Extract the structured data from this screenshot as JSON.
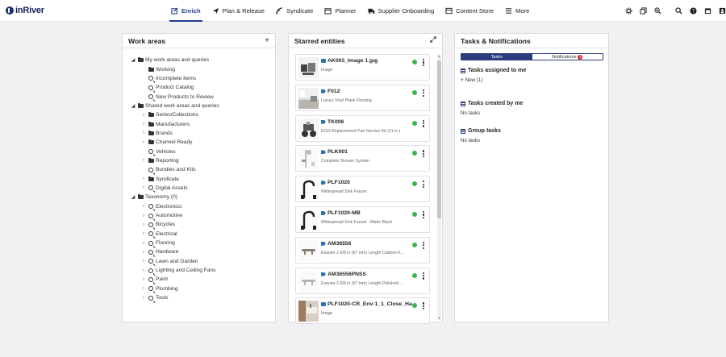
{
  "app": {
    "logo_text": "inRiver"
  },
  "nav": {
    "items": [
      {
        "label": "Enrich",
        "icon": "edit-icon",
        "active": true
      },
      {
        "label": "Plan & Release",
        "icon": "plane-icon"
      },
      {
        "label": "Syndicate",
        "icon": "syndicate-icon"
      },
      {
        "label": "Planner",
        "icon": "calendar-icon"
      },
      {
        "label": "Supplier Onboarding",
        "icon": "truck-icon"
      },
      {
        "label": "Content Store",
        "icon": "content-store-icon"
      },
      {
        "label": "More",
        "icon": "menu-icon"
      }
    ]
  },
  "toolbar": {
    "left_icons": [
      "settings-icon",
      "copy-icon",
      "zoom-in-icon"
    ],
    "right_icons": [
      "search-icon",
      "help-icon",
      "calendar-icon",
      "user-icon"
    ]
  },
  "work_areas": {
    "title": "Work areas",
    "add_label": "+",
    "tree": [
      {
        "label": "My work areas and queries",
        "type": "folder",
        "level": 0,
        "expanded": true
      },
      {
        "label": "Working",
        "type": "folder",
        "level": 1
      },
      {
        "label": "Incomplete Items",
        "type": "query",
        "level": 1
      },
      {
        "label": "Product Catalog",
        "type": "query",
        "level": 1
      },
      {
        "label": "New Products to Review",
        "type": "query",
        "level": 1
      },
      {
        "label": "Shared work areas and queries",
        "type": "folder",
        "level": 0,
        "expanded": true
      },
      {
        "label": "Series/Collections",
        "type": "folder",
        "level": 1,
        "has_children": true
      },
      {
        "label": "Manufacturers",
        "type": "folder",
        "level": 1,
        "has_children": true
      },
      {
        "label": "Brands",
        "type": "folder",
        "level": 1,
        "has_children": true
      },
      {
        "label": "Channel Ready",
        "type": "folder",
        "level": 1,
        "has_children": true
      },
      {
        "label": "Vehicles",
        "type": "query",
        "level": 1
      },
      {
        "label": "Reporting",
        "type": "folder",
        "level": 1,
        "has_children": true
      },
      {
        "label": "Bundles and Kits",
        "type": "query",
        "level": 1
      },
      {
        "label": "Syndicate",
        "type": "folder",
        "level": 1,
        "has_children": true
      },
      {
        "label": "Digital Assets",
        "type": "query",
        "level": 1,
        "has_children": true
      },
      {
        "label": "Taxonomy (0)",
        "type": "folder",
        "level": 0,
        "expanded": true
      },
      {
        "label": "Electronics",
        "type": "query",
        "level": 1,
        "has_children": true
      },
      {
        "label": "Automotive",
        "type": "query",
        "level": 1,
        "has_children": true
      },
      {
        "label": "Bicycles",
        "type": "query",
        "level": 1,
        "has_children": true
      },
      {
        "label": "Electrical",
        "type": "query",
        "level": 1,
        "has_children": true
      },
      {
        "label": "Flooring",
        "type": "query",
        "level": 1,
        "has_children": true
      },
      {
        "label": "Hardware",
        "type": "query",
        "level": 1,
        "has_children": true
      },
      {
        "label": "Lawn and Garden",
        "type": "query",
        "level": 1,
        "has_children": true
      },
      {
        "label": "Lighting and Ceiling Fans",
        "type": "query",
        "level": 1,
        "has_children": true
      },
      {
        "label": "Paint",
        "type": "query",
        "level": 1,
        "has_children": true
      },
      {
        "label": "Plumbing",
        "type": "query",
        "level": 1,
        "has_children": true
      },
      {
        "label": "Tools",
        "type": "query",
        "level": 1,
        "has_children": true
      }
    ]
  },
  "starred": {
    "title": "Starred entities",
    "expand_icon": "expand-icon",
    "status_color": "#3bb54a",
    "cards": [
      {
        "title": "AK003_Image 1.jpg",
        "subtitle": "Image",
        "entity": "image",
        "thumb": "tools-kit"
      },
      {
        "title": "F012",
        "subtitle": "Luxury Vinyl Plank Flooring",
        "entity": "product",
        "thumb": "room"
      },
      {
        "title": "TK006",
        "subtitle": "EGO Replacement Part Service Kit (21 in.)",
        "entity": "product",
        "thumb": "mower"
      },
      {
        "title": "PLK001",
        "subtitle": "Complete Shower System",
        "entity": "product",
        "thumb": "shower"
      },
      {
        "title": "PLF1020",
        "subtitle": "Widespread Sink Faucet",
        "entity": "product",
        "thumb": "faucet"
      },
      {
        "title": "PLF1020-MB",
        "subtitle": "Widespread Sink Faucet - Matte Black",
        "entity": "product",
        "thumb": "faucet"
      },
      {
        "title": "AM36556",
        "subtitle": "Esquire 2-5/8 in (67 mm) Length Cabinet K...",
        "entity": "product",
        "thumb": "handle"
      },
      {
        "title": "AM36556PNSS",
        "subtitle": "Esquire 2-5/8 in (67 mm) Length Polished ...",
        "entity": "product",
        "thumb": "handle-silver"
      },
      {
        "title": "PLF1020-CR_Env-1_1_Close_Ha...",
        "subtitle": "Image",
        "entity": "image",
        "thumb": "bath"
      }
    ]
  },
  "tasks": {
    "title": "Tasks & Notifications",
    "tabs": [
      {
        "label": "Tasks",
        "active": true
      },
      {
        "label": "Notifications",
        "badge": "1"
      }
    ],
    "sections": [
      {
        "title": "Tasks assigned to me",
        "body": "New (1)",
        "has_plus": true
      },
      {
        "title": "Tasks created by me",
        "body": "No tasks"
      },
      {
        "title": "Group tasks",
        "body": "No tasks"
      }
    ]
  },
  "colors": {
    "brand": "#1f2f6e",
    "accent": "#2c3c7c",
    "badge": "#d92b2b"
  }
}
